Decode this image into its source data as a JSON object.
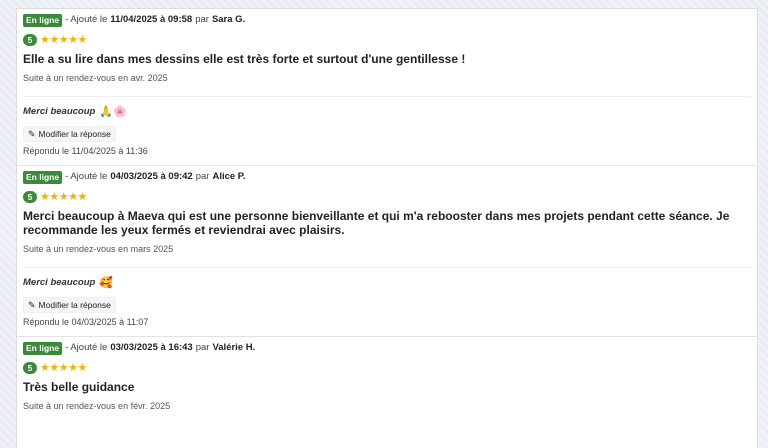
{
  "reviews": [
    {
      "status": "En ligne",
      "added_prefix": "- Ajouté le",
      "date": "11/04/2025 à 09:58",
      "by": "par",
      "author": "Sara G.",
      "score": "5",
      "stars": "★★★★★",
      "comment": "Elle a su lire dans mes dessins elle est très forte et surtout d'une gentillesse !",
      "context": "Suite à un rendez-vous en avr. 2025",
      "reply": "Merci beaucoup",
      "reply_emoji": "🙏🌸",
      "edit_label": "Modifier la réponse",
      "replied_at": "Répondu le 11/04/2025 à 11:36"
    },
    {
      "status": "En ligne",
      "added_prefix": "- Ajouté le",
      "date": "04/03/2025 à 09:42",
      "by": "par",
      "author": "Alice P.",
      "score": "5",
      "stars": "★★★★★",
      "comment": "Merci beaucoup à Maeva qui est une personne bienveillante et qui m'a rebooster dans mes projets pendant cette séance. Je recommande les yeux fermés et reviendrai avec plaisirs.",
      "context": "Suite à un rendez-vous en mars 2025",
      "reply": "Merci beaucoup",
      "reply_emoji": "🥰",
      "edit_label": "Modifier la réponse",
      "replied_at": "Répondu le 04/03/2025 à 11:07"
    },
    {
      "status": "En ligne",
      "added_prefix": "- Ajouté le",
      "date": "03/03/2025 à 16:43",
      "by": "par",
      "author": "Valérie H.",
      "score": "5",
      "stars": "★★★★★",
      "comment": "Très belle guidance",
      "context": "Suite à un rendez-vous en févr. 2025"
    }
  ],
  "icons": {
    "edit": "edit-icon"
  },
  "colors": {
    "badge": "#3a8a3a",
    "stars": "#f0b400"
  }
}
